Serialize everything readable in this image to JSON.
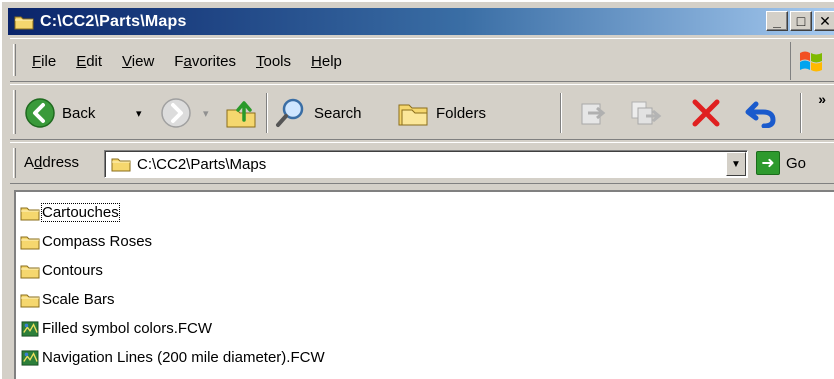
{
  "window": {
    "title": "C:\\CC2\\Parts\\Maps",
    "min_glyph": "_",
    "max_glyph": "□",
    "close_glyph": "✕"
  },
  "menu": {
    "items": [
      {
        "prefix": "",
        "accel": "F",
        "rest": "ile"
      },
      {
        "prefix": "",
        "accel": "E",
        "rest": "dit"
      },
      {
        "prefix": "",
        "accel": "V",
        "rest": "iew"
      },
      {
        "prefix": "F",
        "accel": "a",
        "rest": "vorites"
      },
      {
        "prefix": "",
        "accel": "T",
        "rest": "ools"
      },
      {
        "prefix": "",
        "accel": "H",
        "rest": "elp"
      }
    ]
  },
  "toolbar": {
    "back_label": "Back",
    "search_label": "Search",
    "folders_label": "Folders",
    "more_glyph": "»",
    "dropdown_glyph": "▾"
  },
  "address": {
    "label_prefix": "A",
    "label_accel": "d",
    "label_rest": "dress",
    "value": "C:\\CC2\\Parts\\Maps",
    "go_label": "Go",
    "go_glyph": "➜"
  },
  "files": [
    {
      "name": "Cartouches",
      "type": "folder"
    },
    {
      "name": "Compass Roses",
      "type": "folder"
    },
    {
      "name": "Contours",
      "type": "folder"
    },
    {
      "name": "Scale Bars",
      "type": "folder"
    },
    {
      "name": "Filled symbol colors.FCW",
      "type": "fcw"
    },
    {
      "name": "Navigation Lines (200 mile diameter).FCW",
      "type": "fcw"
    }
  ],
  "colors": {
    "title_gradient_start": "#0a246a",
    "title_gradient_end": "#a6caf0",
    "folder": "#f5d76e",
    "back_button": "#3a9a3a",
    "delete": "#e02020",
    "undo": "#1a5acc"
  }
}
